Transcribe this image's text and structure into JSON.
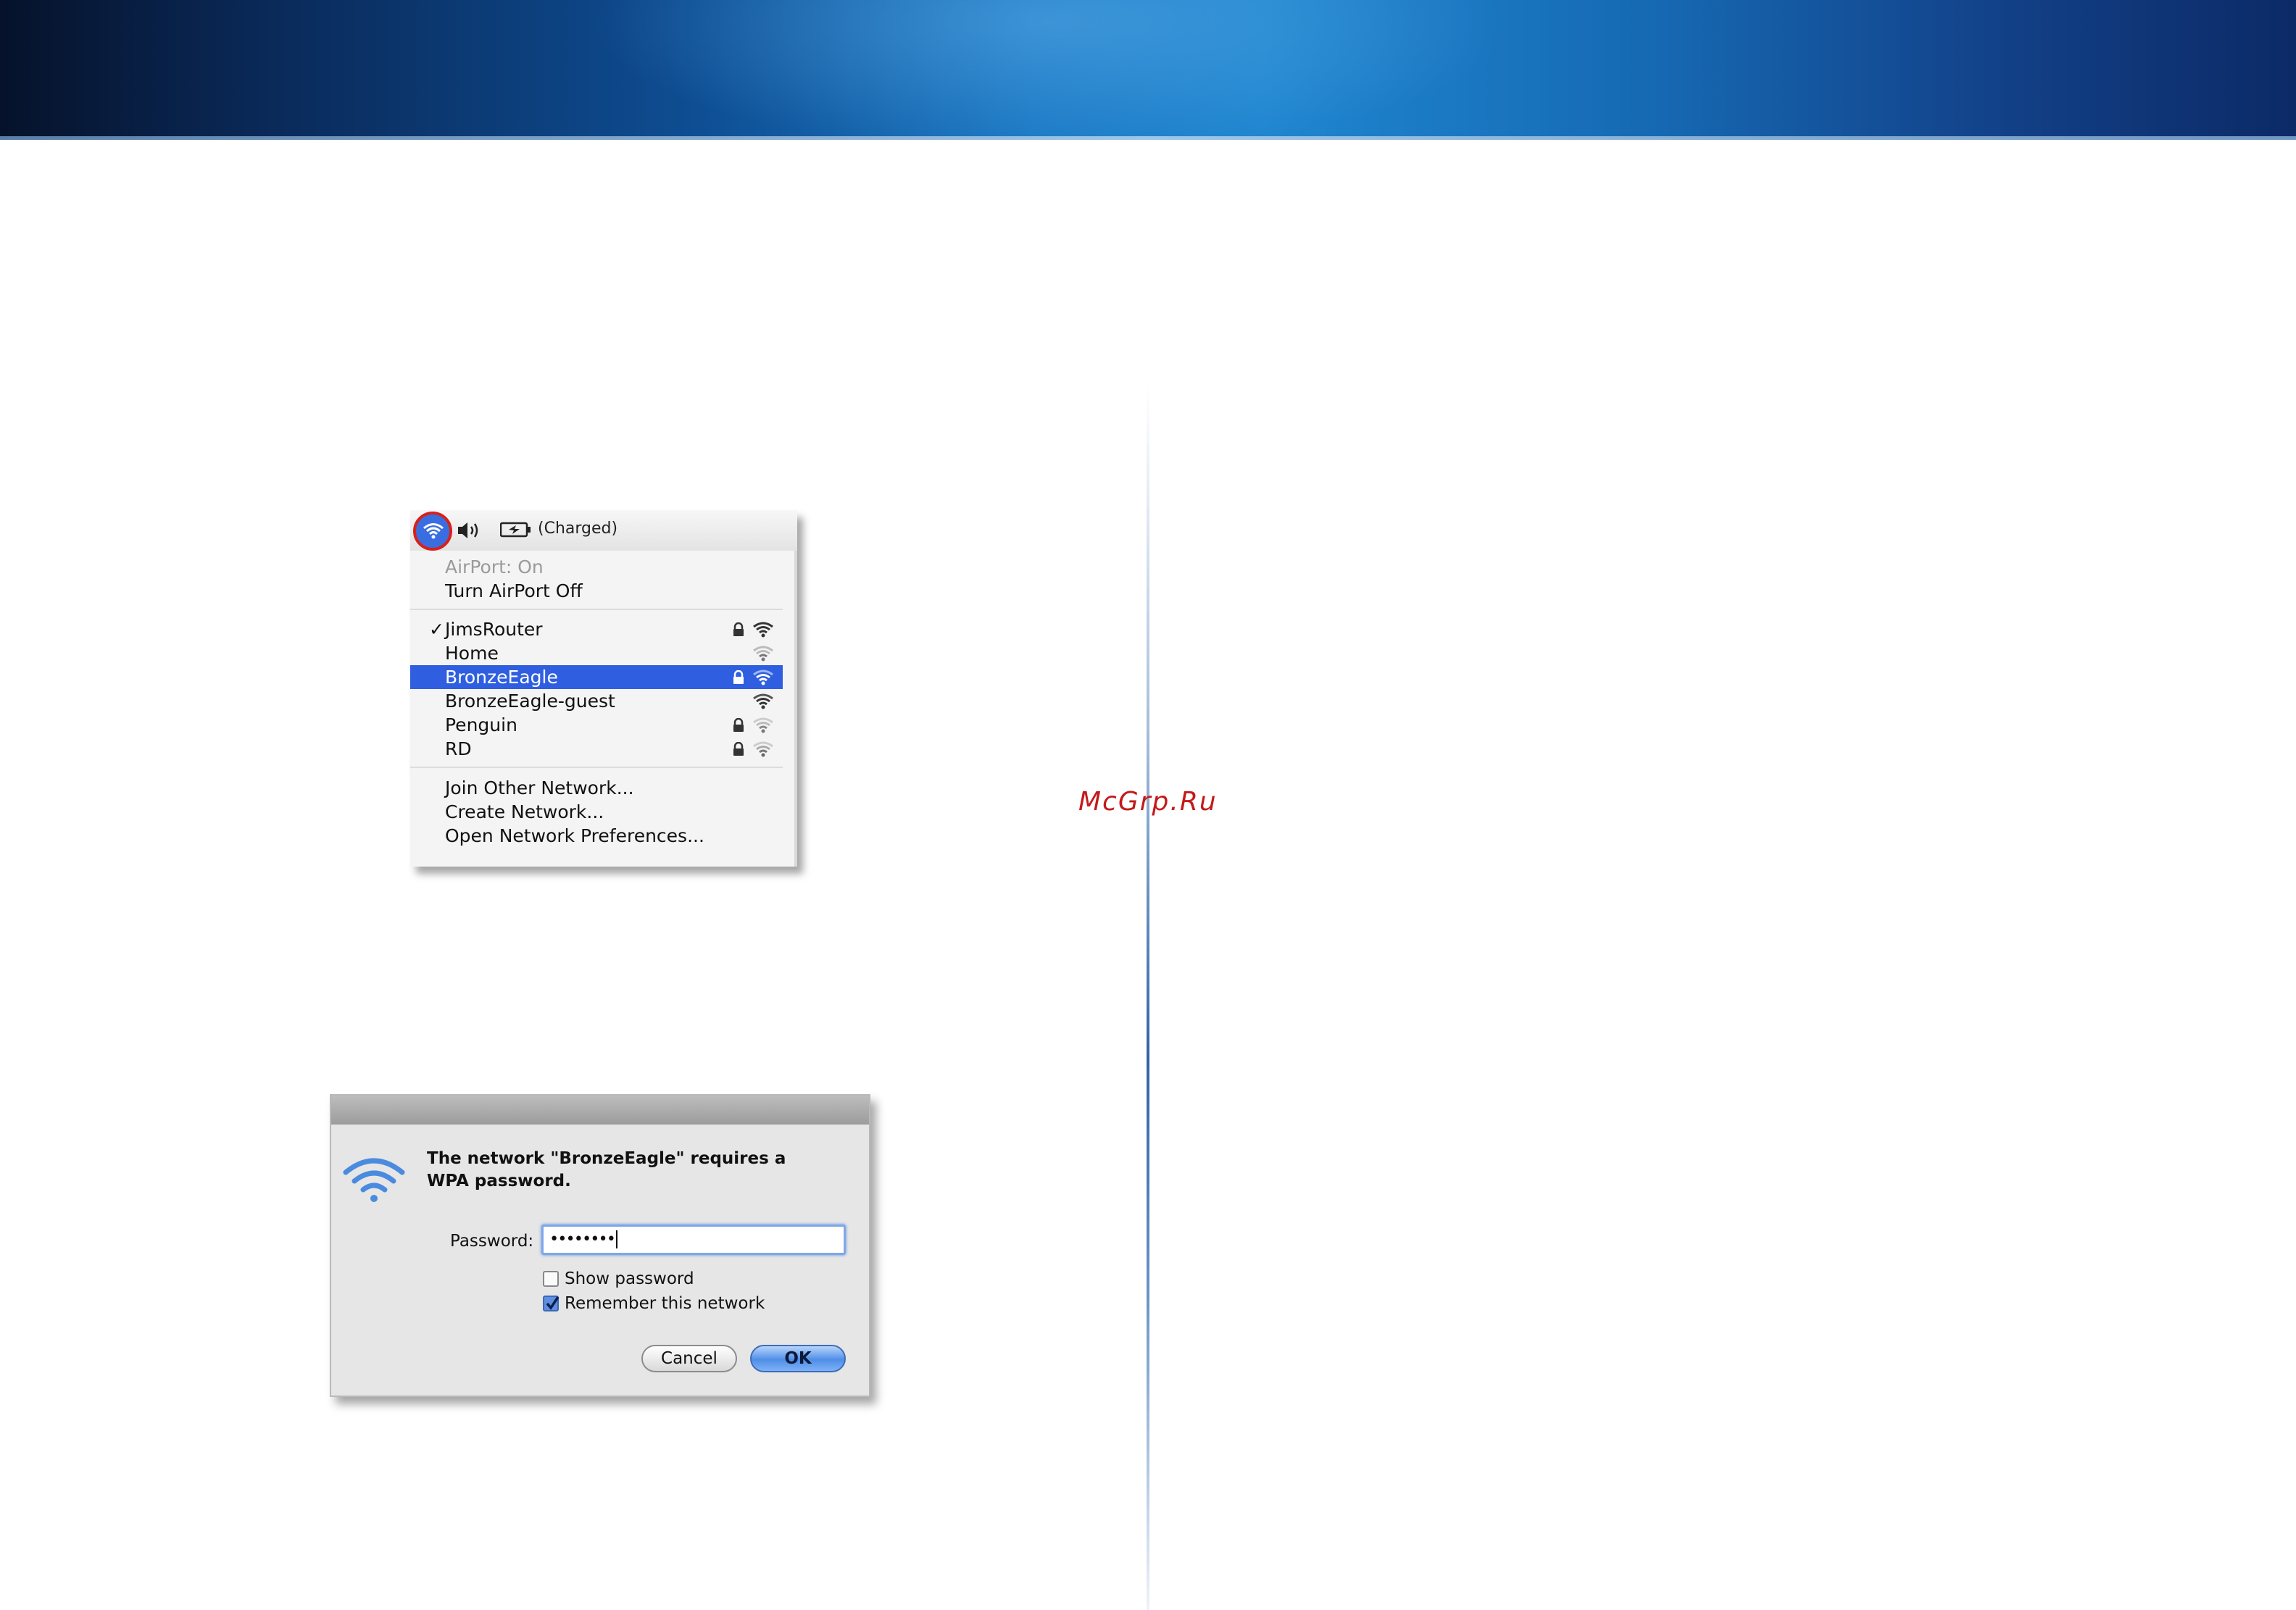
{
  "watermark": "McGrp.Ru",
  "menubar": {
    "wifi_icon": "wifi-icon",
    "volume_icon": "volume-icon",
    "battery_icon": "battery-icon",
    "battery_status": "(Charged)"
  },
  "airport_menu": {
    "status": "AirPort: On",
    "toggle": "Turn AirPort Off",
    "networks": [
      {
        "name": "JimsRouter",
        "checked": true,
        "locked": true,
        "selected": false
      },
      {
        "name": "Home",
        "checked": false,
        "locked": false,
        "selected": false
      },
      {
        "name": "BronzeEagle",
        "checked": false,
        "locked": true,
        "selected": true
      },
      {
        "name": "BronzeEagle-guest",
        "checked": false,
        "locked": false,
        "selected": false
      },
      {
        "name": "Penguin",
        "checked": false,
        "locked": true,
        "selected": false
      },
      {
        "name": "RD",
        "checked": false,
        "locked": true,
        "selected": false
      }
    ],
    "actions": [
      "Join Other Network...",
      "Create Network...",
      "Open Network Preferences..."
    ]
  },
  "dialog": {
    "message": "The network \"BronzeEagle\" requires a WPA password.",
    "password_label": "Password:",
    "password_value": "••••••••",
    "show_password_label": "Show password",
    "show_password_checked": false,
    "remember_label": "Remember this network",
    "remember_checked": true,
    "cancel_label": "Cancel",
    "ok_label": "OK"
  },
  "colors": {
    "selection": "#2f5fe0",
    "highlight_circle": "#d8201a",
    "ok_button": "#4f8ee8"
  }
}
